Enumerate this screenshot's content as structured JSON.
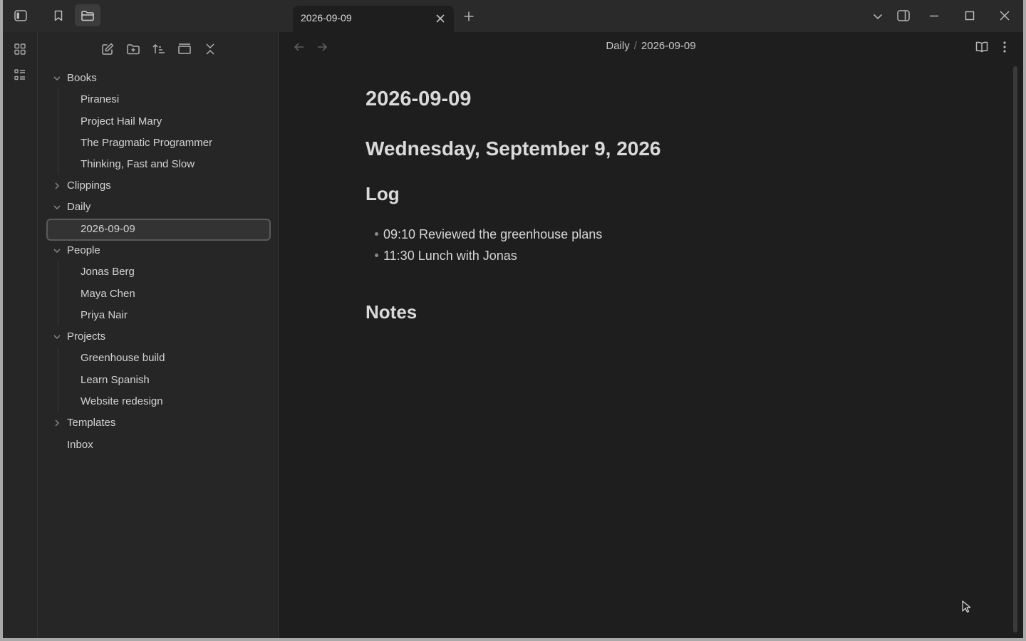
{
  "titlebar": {
    "tab_title": "2026-09-09"
  },
  "sidebar": {
    "tree": [
      {
        "type": "folder",
        "label": "Books",
        "expanded": true
      },
      {
        "type": "file",
        "label": "Piranesi"
      },
      {
        "type": "file",
        "label": "Project Hail Mary"
      },
      {
        "type": "file",
        "label": "The Pragmatic Programmer"
      },
      {
        "type": "file",
        "label": "Thinking, Fast and Slow"
      },
      {
        "type": "folder",
        "label": "Clippings",
        "expanded": false
      },
      {
        "type": "folder",
        "label": "Daily",
        "expanded": true
      },
      {
        "type": "file",
        "label": "2026-09-09",
        "selected": true
      },
      {
        "type": "folder",
        "label": "People",
        "expanded": true
      },
      {
        "type": "file",
        "label": "Jonas Berg"
      },
      {
        "type": "file",
        "label": "Maya Chen"
      },
      {
        "type": "file",
        "label": "Priya Nair"
      },
      {
        "type": "folder",
        "label": "Projects",
        "expanded": true
      },
      {
        "type": "file",
        "label": "Greenhouse build"
      },
      {
        "type": "file",
        "label": "Learn Spanish"
      },
      {
        "type": "file",
        "label": "Website redesign"
      },
      {
        "type": "folder",
        "label": "Templates",
        "expanded": false
      },
      {
        "type": "rootfile",
        "label": "Inbox"
      }
    ]
  },
  "editor": {
    "breadcrumb_folder": "Daily",
    "breadcrumb_separator": "/",
    "breadcrumb_file": "2026-09-09",
    "title": "2026-09-09",
    "heading_date": "Wednesday, September 9, 2026",
    "heading_log": "Log",
    "log_items": [
      "09:10 Reviewed the greenhouse plans",
      "11:30 Lunch with Jonas"
    ],
    "heading_notes": "Notes"
  },
  "icons": {
    "titlebar": [
      "sidebar-toggle-icon",
      "bookmark-icon",
      "folder-icon",
      "close-icon",
      "plus-icon",
      "chevron-down-icon",
      "right-sidebar-icon",
      "minimize-icon",
      "maximize-icon",
      "window-close-icon"
    ],
    "ribbon": [
      "canvas-grid-icon",
      "outline-list-icon"
    ],
    "sidebar_toolbar": [
      "new-note-icon",
      "new-folder-icon",
      "sort-icon",
      "collapse-view-icon",
      "collapse-all-icon"
    ],
    "editor": [
      "back-arrow-icon",
      "forward-arrow-icon",
      "reading-view-icon",
      "more-options-icon"
    ]
  },
  "colors": {
    "background": "#1e1e1e",
    "sidebar": "#262626",
    "titlebar": "#2a2a2a",
    "text": "#dadada"
  }
}
